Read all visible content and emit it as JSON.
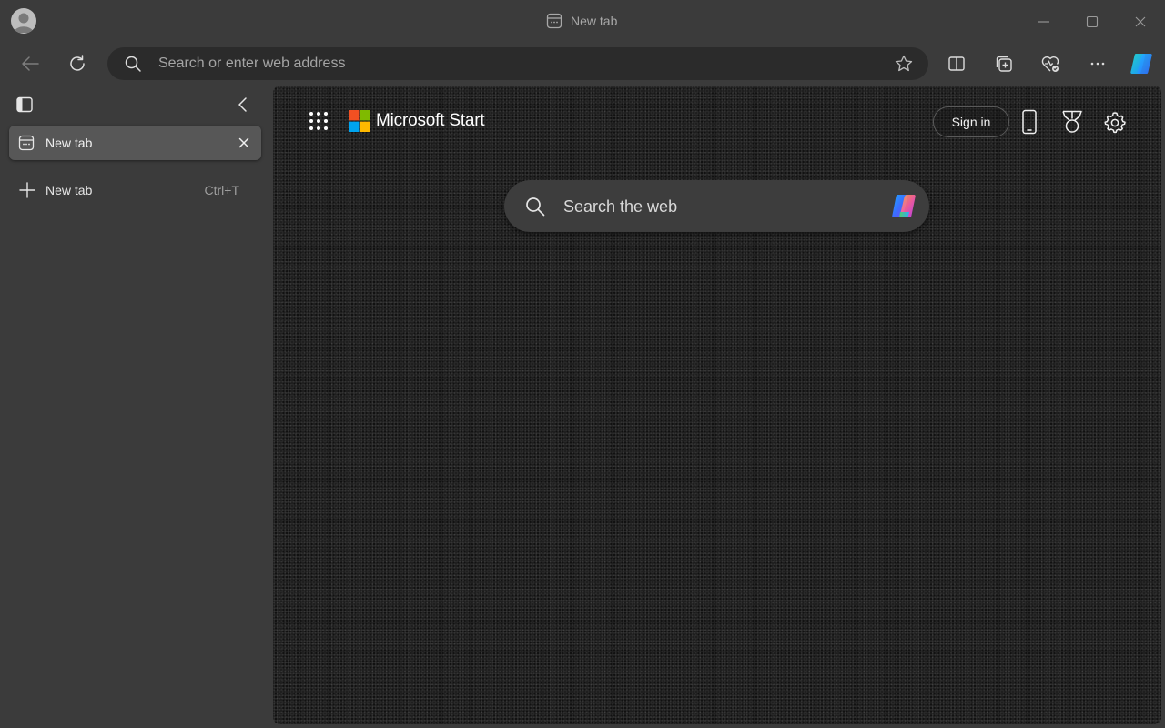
{
  "window": {
    "title": "New tab",
    "controls": [
      "minimize-icon",
      "maximize-icon",
      "close-icon"
    ]
  },
  "toolbar": {
    "address_placeholder": "Search or enter web address",
    "buttons": [
      "back-icon",
      "refresh-icon",
      "favorite-star-icon",
      "split-screen-icon",
      "collections-icon",
      "browser-essentials-icon",
      "more-icon",
      "copilot-icon"
    ]
  },
  "sidebar": {
    "tabs": [
      {
        "label": "New tab"
      }
    ],
    "new_tab": {
      "label": "New tab",
      "shortcut": "Ctrl+T"
    }
  },
  "page": {
    "brand": "Microsoft Start",
    "sign_in": "Sign in",
    "search_placeholder": "Search the web",
    "logo_colors": [
      "#f25022",
      "#7fba00",
      "#00a4ef",
      "#ffb900"
    ]
  }
}
